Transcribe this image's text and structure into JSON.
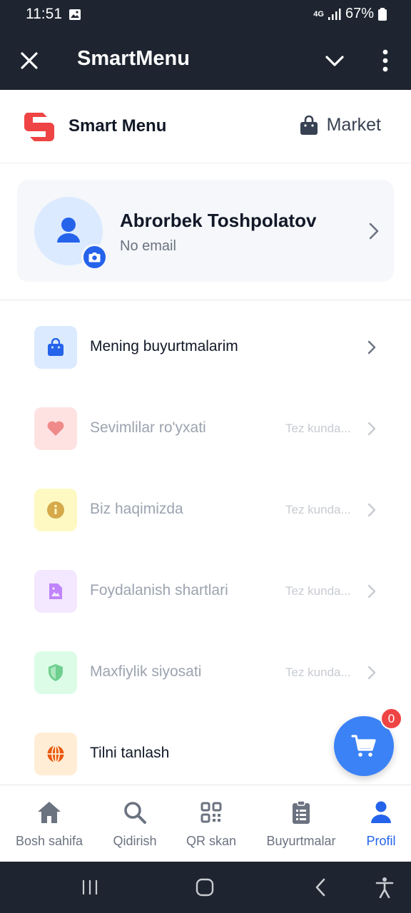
{
  "status": {
    "time": "11:51",
    "network": "4G",
    "battery": "67%"
  },
  "app_bar": {
    "title": "SmartMenu"
  },
  "brand": {
    "name": "Smart Menu",
    "market_label": "Market"
  },
  "profile": {
    "name": "Abrorbek Toshpolatov",
    "email": "No email"
  },
  "menu": [
    {
      "label": "Mening buyurtmalarim",
      "icon": "shopping-bag-icon",
      "icon_bg": "#dbeafe",
      "icon_color": "#2563eb",
      "soon": ""
    },
    {
      "label": "Sevimlilar ro'yxati",
      "icon": "heart-icon",
      "icon_bg": "#fee2e2",
      "icon_color": "#f08a8a",
      "soon": "Tez kunda..."
    },
    {
      "label": "Biz haqimizda",
      "icon": "info-icon",
      "icon_bg": "#fef9c3",
      "icon_color": "#d6a94a",
      "soon": "Tez kunda..."
    },
    {
      "label": "Foydalanish shartlari",
      "icon": "document-icon",
      "icon_bg": "#f3e8ff",
      "icon_color": "#c084fc",
      "soon": "Tez kunda..."
    },
    {
      "label": "Maxfiylik siyosati",
      "icon": "shield-icon",
      "icon_bg": "#dcfce7",
      "icon_color": "#6fcf8e",
      "soon": "Tez kunda..."
    },
    {
      "label": "Tilni tanlash",
      "icon": "globe-icon",
      "icon_bg": "#ffedd5",
      "icon_color": "#ea580c",
      "soon": ""
    }
  ],
  "cart": {
    "count": "0"
  },
  "bottom_nav": [
    {
      "label": "Bosh sahifa",
      "icon": "home-icon"
    },
    {
      "label": "Qidirish",
      "icon": "search-icon"
    },
    {
      "label": "QR skan",
      "icon": "qr-code-icon"
    },
    {
      "label": "Buyurtmalar",
      "icon": "clipboard-icon"
    },
    {
      "label": "Profil",
      "icon": "user-icon",
      "active": true
    }
  ],
  "colors": {
    "accent": "#2563eb",
    "fab": "#3b82f6",
    "dark_bar": "#1e2530",
    "badge": "#ef4444"
  }
}
